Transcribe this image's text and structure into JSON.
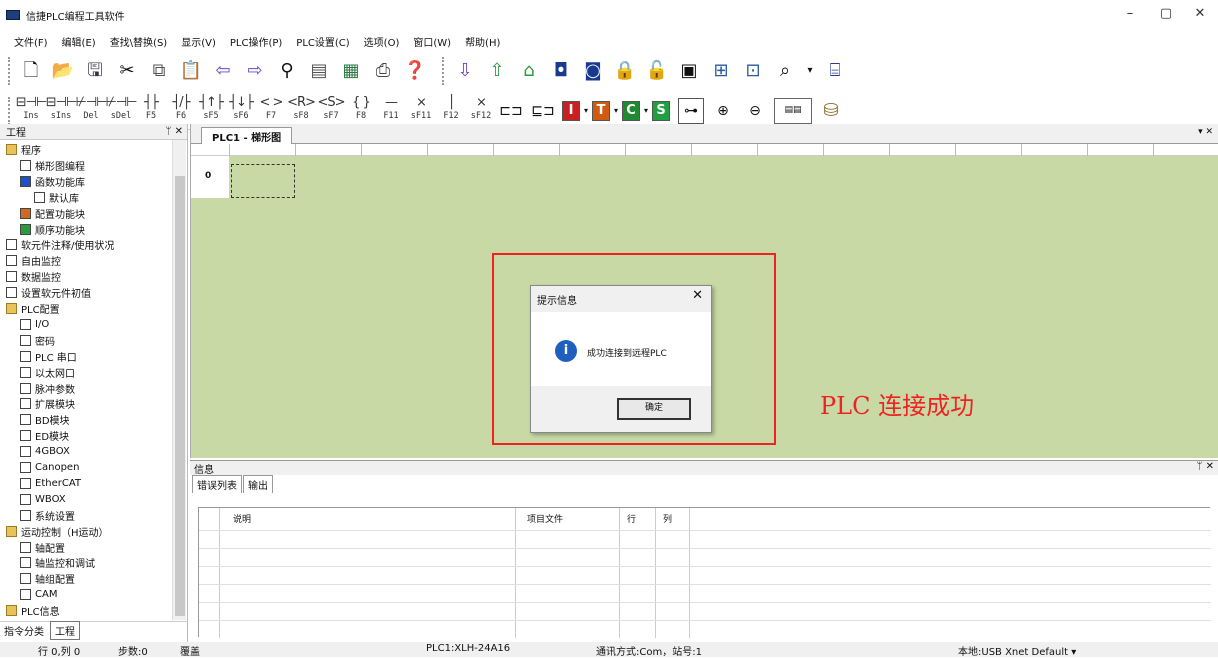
{
  "window": {
    "title": "信捷PLC编程工具软件",
    "min_label": "–",
    "max_label": "▢",
    "close_label": "✕"
  },
  "menu": [
    "文件(F)",
    "编辑(E)",
    "查找\\替换(S)",
    "显示(V)",
    "PLC操作(P)",
    "PLC设置(C)",
    "选项(O)",
    "窗口(W)",
    "帮助(H)"
  ],
  "toolbar1": [
    "new-file-icon",
    "open-folder-icon",
    "save-icon",
    "cut-icon",
    "copy-icon",
    "paste-icon",
    "undo-arrow-icon",
    "redo-arrow-icon",
    "find-icon",
    "document-icon",
    "document2-icon",
    "print-icon",
    "help-icon",
    "download-icon",
    "upload-icon",
    "run-icon",
    "stop-icon",
    "lock-icon",
    "unlock-icon",
    "monitor-icon",
    "table-icon",
    "preview-icon",
    "zoom-icon"
  ],
  "toolbar2": {
    "keys": [
      {
        "g": "⊟⊣⊢",
        "k": "Ins"
      },
      {
        "g": "⊟⊣⊢",
        "k": "sIns"
      },
      {
        "g": "⊬⊣⊢",
        "k": "Del"
      },
      {
        "g": "⊬⊣⊢",
        "k": "sDel"
      },
      {
        "g": "┤├",
        "k": "F5"
      },
      {
        "g": "┤/├",
        "k": "F6"
      },
      {
        "g": "┤↑├",
        "k": "sF5"
      },
      {
        "g": "┤↓├",
        "k": "sF6"
      },
      {
        "g": "< >",
        "k": "F7"
      },
      {
        "g": "<R>",
        "k": "sF8"
      },
      {
        "g": "<S>",
        "k": "sF7"
      },
      {
        "g": "{ }",
        "k": "F8"
      },
      {
        "g": "—",
        "k": "F11"
      },
      {
        "g": "⨯",
        "k": "sF11"
      },
      {
        "g": "│",
        "k": "F12"
      },
      {
        "g": "⨯",
        "k": "sF12"
      }
    ],
    "letters": [
      {
        "t": "I",
        "c": "#c92020"
      },
      {
        "t": "T",
        "c": "#d05a10"
      },
      {
        "t": "C",
        "c": "#208a30"
      },
      {
        "t": "S",
        "c": "#20a040"
      }
    ]
  },
  "project_panel": {
    "title": "工程",
    "pin": "ᛘ ✕",
    "tabs": [
      "指令分类",
      "工程"
    ]
  },
  "tree": [
    {
      "label": "程序",
      "level": 0,
      "icon": "folder"
    },
    {
      "label": "梯形图编程",
      "level": 1,
      "icon": "ladder"
    },
    {
      "label": "函数功能库",
      "level": 1,
      "icon": "function"
    },
    {
      "label": "默认库",
      "level": 2,
      "icon": "lib"
    },
    {
      "label": "配置功能块",
      "level": 1,
      "icon": "config"
    },
    {
      "label": "顺序功能块",
      "level": 1,
      "icon": "sfc"
    },
    {
      "label": "软元件注释/使用状况",
      "level": 0,
      "icon": "comment"
    },
    {
      "label": "自由监控",
      "level": 0,
      "icon": "monitor"
    },
    {
      "label": "数据监控",
      "level": 0,
      "icon": "monitor"
    },
    {
      "label": "设置软元件初值",
      "level": 0,
      "icon": "set"
    },
    {
      "label": "PLC配置",
      "level": 0,
      "icon": "folder"
    },
    {
      "label": "I/O",
      "level": 1,
      "icon": "io"
    },
    {
      "label": "密码",
      "level": 1,
      "icon": "password"
    },
    {
      "label": "PLC 串口",
      "level": 1,
      "icon": "serial"
    },
    {
      "label": "以太网口",
      "level": 1,
      "icon": "ethernet"
    },
    {
      "label": "脉冲参数",
      "level": 1,
      "icon": "pulse"
    },
    {
      "label": "扩展模块",
      "level": 1,
      "icon": "module"
    },
    {
      "label": "BD模块",
      "level": 1,
      "icon": "bd"
    },
    {
      "label": "ED模块",
      "level": 1,
      "icon": "ed"
    },
    {
      "label": "4GBOX",
      "level": 1,
      "icon": "box"
    },
    {
      "label": "Canopen",
      "level": 1,
      "icon": "can"
    },
    {
      "label": "EtherCAT",
      "level": 1,
      "icon": "ecat"
    },
    {
      "label": "WBOX",
      "level": 1,
      "icon": "wbox"
    },
    {
      "label": "系统设置",
      "level": 1,
      "icon": "gear"
    },
    {
      "label": "运动控制（H运动）",
      "level": 0,
      "icon": "folder"
    },
    {
      "label": "轴配置",
      "level": 1,
      "icon": "axis"
    },
    {
      "label": "轴监控和调试",
      "level": 1,
      "icon": "axis"
    },
    {
      "label": "轴组配置",
      "level": 1,
      "icon": "axis"
    },
    {
      "label": "CAM",
      "level": 1,
      "icon": "cam"
    },
    {
      "label": "PLC信息",
      "level": 0,
      "icon": "folder"
    }
  ],
  "editor": {
    "tab": "PLC1 - 梯形图",
    "row0": "0",
    "arrow": "▾ ✕"
  },
  "dialog": {
    "title": "提示信息",
    "close": "✕",
    "icon": "i",
    "message": "成功连接到远程PLC",
    "ok": "确定"
  },
  "annotation": "PLC 连接成功",
  "info_panel": {
    "title": "信息",
    "pin": "ᛘ ✕",
    "tabs": [
      "错误列表",
      "输出"
    ],
    "columns": [
      "说明",
      "项目文件",
      "行",
      "列"
    ]
  },
  "status": {
    "pos": "行 0,列 0",
    "steps": "步数:0",
    "mode": "覆盖",
    "plc": "PLC1:XLH-24A16",
    "comm": "通讯方式:Com，站号:1",
    "local": "本地:USB Xnet Default  ▾"
  }
}
